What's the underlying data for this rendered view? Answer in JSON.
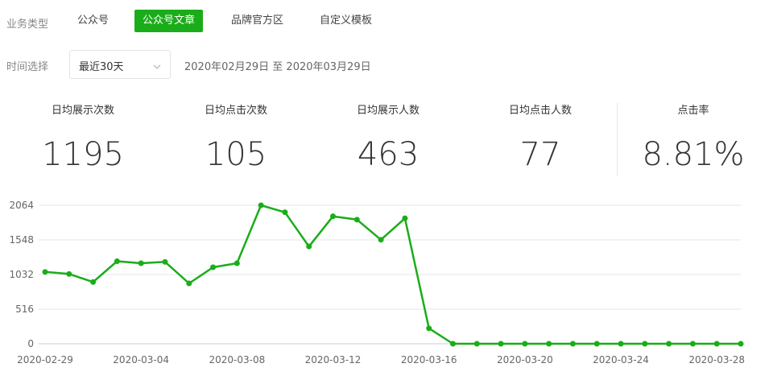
{
  "filters": {
    "business_type_label": "业务类型",
    "tabs": [
      {
        "label": "公众号",
        "active": false
      },
      {
        "label": "公众号文章",
        "active": true
      },
      {
        "label": "品牌官方区",
        "active": false
      },
      {
        "label": "自定义模板",
        "active": false
      }
    ],
    "time_label": "时间选择",
    "time_select_value": "最近30天",
    "date_range": "2020年02月29日 至 2020年03月29日",
    "icons": {
      "dropdown": "chevron-down-icon"
    }
  },
  "stats": [
    {
      "title": "日均展示次数",
      "value": "1195"
    },
    {
      "title": "日均点击次数",
      "value": "105"
    },
    {
      "title": "日均展示人数",
      "value": "463"
    },
    {
      "title": "日均点击人数",
      "value": "77"
    },
    {
      "title": "点击率",
      "value": "8.81%"
    }
  ],
  "colors": {
    "accent": "#1aad19",
    "text": "#333333",
    "muted": "#888888",
    "grid": "#e6e6e6"
  },
  "chart_data": {
    "type": "line",
    "title": "",
    "xlabel": "",
    "ylabel": "",
    "ylim": [
      0,
      2064
    ],
    "yticks": [
      0,
      516,
      1032,
      1548,
      2064
    ],
    "grid": true,
    "legend": "none",
    "x_tick_labels": [
      "2020-02-29",
      "2020-03-04",
      "2020-03-08",
      "2020-03-12",
      "2020-03-16",
      "2020-03-20",
      "2020-03-24",
      "2020-03-28"
    ],
    "x": [
      "2020-02-29",
      "2020-03-01",
      "2020-03-02",
      "2020-03-03",
      "2020-03-04",
      "2020-03-05",
      "2020-03-06",
      "2020-03-07",
      "2020-03-08",
      "2020-03-09",
      "2020-03-10",
      "2020-03-11",
      "2020-03-12",
      "2020-03-13",
      "2020-03-14",
      "2020-03-15",
      "2020-03-16",
      "2020-03-17",
      "2020-03-18",
      "2020-03-19",
      "2020-03-20",
      "2020-03-21",
      "2020-03-22",
      "2020-03-23",
      "2020-03-24",
      "2020-03-25",
      "2020-03-26",
      "2020-03-27",
      "2020-03-28",
      "2020-03-29"
    ],
    "series": [
      {
        "values": [
          1070,
          1040,
          920,
          1230,
          1200,
          1220,
          900,
          1140,
          1200,
          2064,
          1960,
          1450,
          1900,
          1850,
          1550,
          1870,
          230,
          0,
          0,
          0,
          0,
          0,
          0,
          0,
          0,
          0,
          0,
          0,
          0,
          0
        ],
        "color": "#1aad19"
      }
    ]
  }
}
